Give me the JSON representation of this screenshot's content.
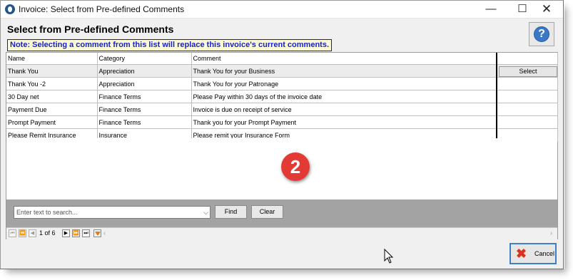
{
  "window": {
    "title": "Invoice:  Select from Pre-defined Comments",
    "min_glyph": "—",
    "max_glyph": "☐",
    "close_glyph": "✕"
  },
  "heading": "Select from Pre-defined Comments",
  "note": "Note:  Selecting a comment from this list will replace this invoice's current comments.",
  "help": {
    "glyph": "?"
  },
  "table": {
    "columns": [
      "Name",
      "Category",
      "Comment"
    ],
    "rows": [
      {
        "name": "Thank You",
        "category": "Appreciation",
        "comment": "Thank You for your Business"
      },
      {
        "name": "Thank You -2",
        "category": "Appreciation",
        "comment": "Thank You for your Patronage"
      },
      {
        "name": "30 Day net",
        "category": "Finance Terms",
        "comment": "Please Pay within 30 days of the  invoice date"
      },
      {
        "name": "Payment Due",
        "category": "Finance Terms",
        "comment": "Invoice is due on receipt of service"
      },
      {
        "name": "Prompt Payment",
        "category": "Finance Terms",
        "comment": "Thank you for your Prompt Payment"
      },
      {
        "name": "Please Remit Insurance",
        "category": "Insurance",
        "comment": "Please remit your Insurance Form"
      }
    ],
    "select_label": "Select"
  },
  "badge": "2",
  "search": {
    "placeholder": "Enter text to search...",
    "find_label": "Find",
    "clear_label": "Clear"
  },
  "pager": {
    "page_indicator": "1 of 6"
  },
  "cancel_label": "Cancel",
  "colors": {
    "note_text": "#1822c9",
    "badge": "#e43a36",
    "cancel_border": "#3c7fc4"
  }
}
